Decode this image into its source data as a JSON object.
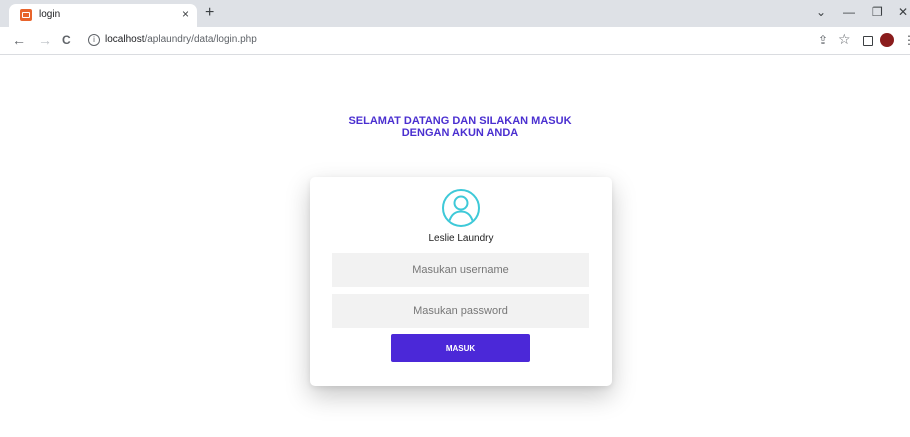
{
  "browser": {
    "tab_title": "login",
    "tab_close": "×",
    "new_tab": "+",
    "window_controls": {
      "tabsearch": "⌄",
      "minimize": "—",
      "restore": "❐",
      "close": "✕"
    },
    "url_host": "localhost",
    "url_path": "/aplaundry/data/login.php",
    "nav": {
      "back": "←",
      "forward": "→",
      "reload": "C"
    },
    "info": "i",
    "share": "⇪",
    "star": "☆",
    "menu": "⋮",
    "favicon_color": "#e8642c"
  },
  "page": {
    "heading_line1": "SELAMAT DATANG DAN SILAKAN MASUK",
    "heading_line2": "DENGAN AKUN ANDA",
    "heading_color": "#4a2fd0",
    "brand": "Leslie Laundry",
    "avatar_icon": "user-circle-icon",
    "avatar_color": "#3ec9d8",
    "username_placeholder": "Masukan username",
    "password_placeholder": "Masukan password",
    "submit_label": "MASUK",
    "submit_color": "#4b28d8"
  }
}
